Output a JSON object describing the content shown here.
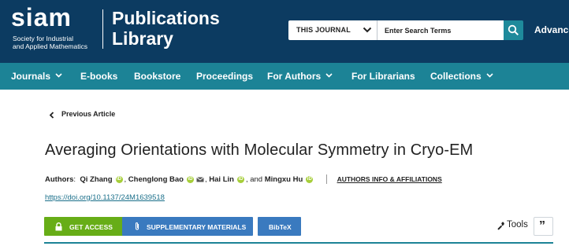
{
  "header": {
    "logo_text": "siam",
    "logo_tagline": "Society for Industrial and Applied Mathematics",
    "logo_tagline_line1": "Society for Industrial",
    "logo_tagline_line2": "and Applied Mathematics",
    "site_title_line1": "Publications",
    "site_title_line2": "Library",
    "search_scope": "THIS JOURNAL",
    "search_placeholder": "Enter Search Terms",
    "advanced_label": "Advance"
  },
  "nav": {
    "items": [
      {
        "label": "Journals",
        "dropdown": true
      },
      {
        "label": "E-books",
        "dropdown": false
      },
      {
        "label": "Bookstore",
        "dropdown": false
      },
      {
        "label": "Proceedings",
        "dropdown": false
      },
      {
        "label": "For Authors",
        "dropdown": true
      },
      {
        "label": "For Librarians",
        "dropdown": false
      },
      {
        "label": "Collections",
        "dropdown": true
      }
    ]
  },
  "article": {
    "previous_label": "Previous Article",
    "title": "Averaging Orientations with Molecular Symmetry in Cryo-EM",
    "authors_label": "Authors",
    "authors": [
      "Qi Zhang",
      "Chenglong Bao",
      "Hai Lin",
      "Mingxu Hu"
    ],
    "joiner_and": ", and ",
    "joiner_comma": ", ",
    "affiliations_label": "AUTHORS INFO & AFFILIATIONS",
    "doi": "https://doi.org/10.1137/24M1639518"
  },
  "actions": {
    "get_access": "GET ACCESS",
    "supplementary": "SUPPLEMENTARY MATERIALS",
    "bibtex": "BibTeX",
    "tools": "Tools",
    "cite": "”"
  },
  "colors": {
    "header_bg": "#0c3b61",
    "nav_bg": "#1c8396",
    "access_green": "#67ad17",
    "button_blue": "#3a7abf",
    "orcid_green": "#a6ce39",
    "link_teal": "#1a6f8a"
  }
}
